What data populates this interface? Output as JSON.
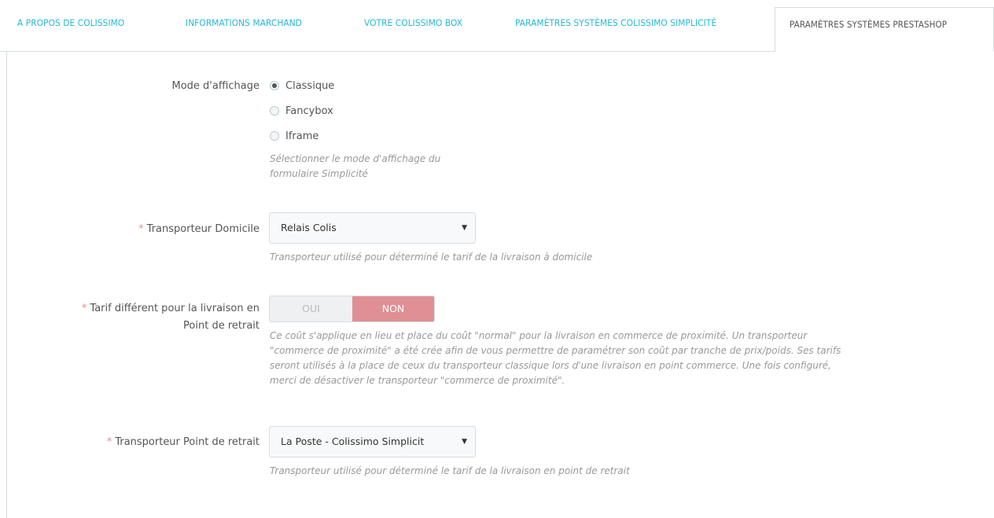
{
  "tabs": [
    {
      "label": "A PROPOS DE COLISSIMO"
    },
    {
      "label": "INFORMATIONS MARCHAND"
    },
    {
      "label": "VOTRE COLISSIMO BOX"
    },
    {
      "label": "PARAMÈTRES SYSTÈMES COLISSIMO SIMPLICITÉ"
    },
    {
      "label": "PARAMÈTRES SYSTÈMES PRESTASHOP",
      "active": true
    }
  ],
  "display_mode": {
    "label": "Mode d'affichage",
    "options": [
      "Classique",
      "Fancybox",
      "Iframe"
    ],
    "selected": "Classique",
    "help": [
      "Sélectionner le mode d'affichage du",
      "formulaire Simplicité"
    ]
  },
  "home_carrier": {
    "required_mark": "*",
    "label": "Transporteur Domicile",
    "value": "Relais Colis",
    "help": "Transporteur utilisé pour déterminé le tarif de la livraison à domicile"
  },
  "pickup_rate": {
    "required_mark": "*",
    "label_line1": "Tarif différent pour la livraison en",
    "label_line2": "Point de retrait",
    "yes_label": "OUI",
    "no_label": "NON",
    "selected": "NON",
    "help": [
      "Ce coût s'applique en lieu et place du coût \"normal\" pour la livraison en commerce de proximité. Un transporteur",
      "\"commerce de proximité\" a été crée afin de vous permettre de paramétrer son coût par tranche de prix/poids. Ses tarifs",
      "seront utilisés à la place de ceux du transporteur classique lors d'une livraison en point commerce. Une fois configuré,",
      "merci de désactiver le transporteur \"commerce de proximité\"."
    ]
  },
  "pickup_carrier": {
    "required_mark": "*",
    "label": "Transporteur Point de retrait",
    "value": "La Poste - Colissimo Simplicit",
    "help": "Transporteur utilisé pour déterminé le tarif de la livraison en point de retrait"
  },
  "colors": {
    "accent": "#25b9d7",
    "switch_off": "#e08f95",
    "help_text": "#999999"
  },
  "icons": {
    "select_caret": "triangle-down-icon"
  }
}
